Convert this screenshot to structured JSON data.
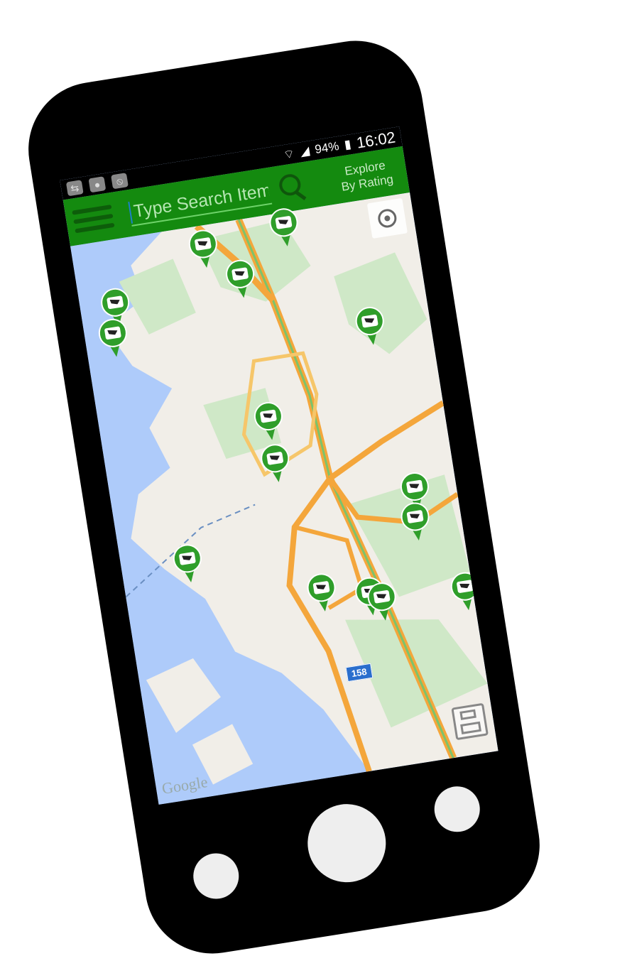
{
  "status": {
    "battery": "94%",
    "time": "16:02"
  },
  "appbar": {
    "search_placeholder": "Type Search Item",
    "explore_line1": "Explore",
    "explore_line2": "By Rating"
  },
  "map": {
    "route_number": "158",
    "attribution": "Google"
  },
  "colors": {
    "appbar": "#148a0f",
    "pin": "#2f9e2a",
    "water": "#aecbfa",
    "land": "#f1eee8",
    "park": "#cfe8c7",
    "road": "#f4a63b"
  },
  "pin_count": 16
}
